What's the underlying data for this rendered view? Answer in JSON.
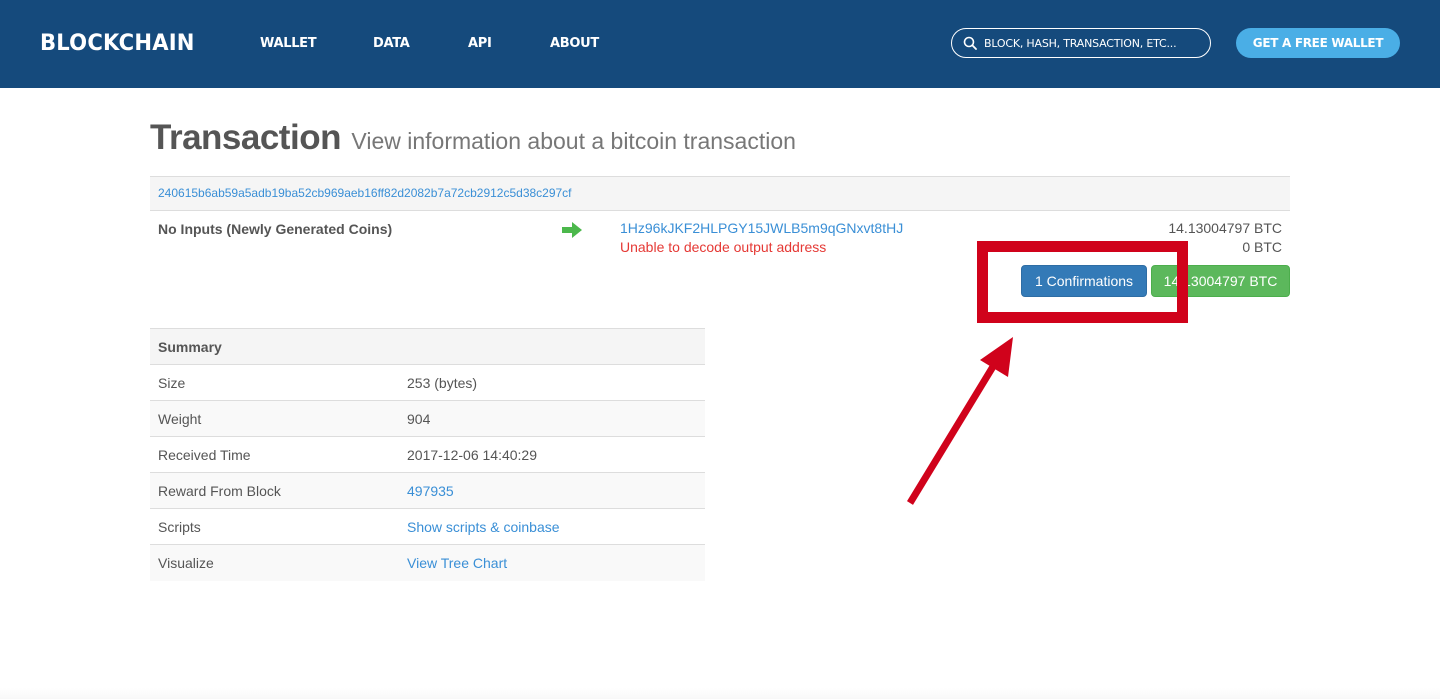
{
  "navbar": {
    "logo": "BLOCKCHAIN",
    "links": [
      "WALLET",
      "DATA",
      "API",
      "ABOUT"
    ],
    "search_placeholder": "BLOCK, HASH, TRANSACTION, ETC...",
    "cta_label": "GET A FREE WALLET",
    "bg_color": "#154a7c",
    "cta_color": "#4aaee6"
  },
  "page": {
    "title": "Transaction",
    "subtitle": "View information about a bitcoin transaction"
  },
  "transaction": {
    "hash": "240615b6ab59a5adb19ba52cb969aeb16ff82d2082b7a72cb2912c5d38c297cf",
    "inputs_label": "No Inputs (Newly Generated Coins)",
    "outputs": [
      {
        "address": "1Hz96kJKF2HLPGY15JWLB5m9qGNxvt8tHJ",
        "amount": "14.13004797 BTC"
      },
      {
        "address": "Unable to decode output address",
        "amount": "0 BTC"
      }
    ],
    "confirmations_label": "1 Confirmations",
    "total_label": "14.13004797 BTC"
  },
  "summary": {
    "header": "Summary",
    "rows": [
      {
        "key": "Size",
        "value": "253 (bytes)",
        "link": false
      },
      {
        "key": "Weight",
        "value": "904",
        "link": false
      },
      {
        "key": "Received Time",
        "value": "2017-12-06 14:40:29",
        "link": false
      },
      {
        "key": "Reward From Block",
        "value": "497935",
        "link": true
      },
      {
        "key": "Scripts",
        "value": "Show scripts & coinbase",
        "link": true
      },
      {
        "key": "Visualize",
        "value": "View Tree Chart",
        "link": true
      }
    ]
  },
  "annotation": {
    "color": "#d0021b",
    "target": "confirmations"
  },
  "icons": {
    "search": "search-icon",
    "arrow": "arrow-right-icon"
  }
}
